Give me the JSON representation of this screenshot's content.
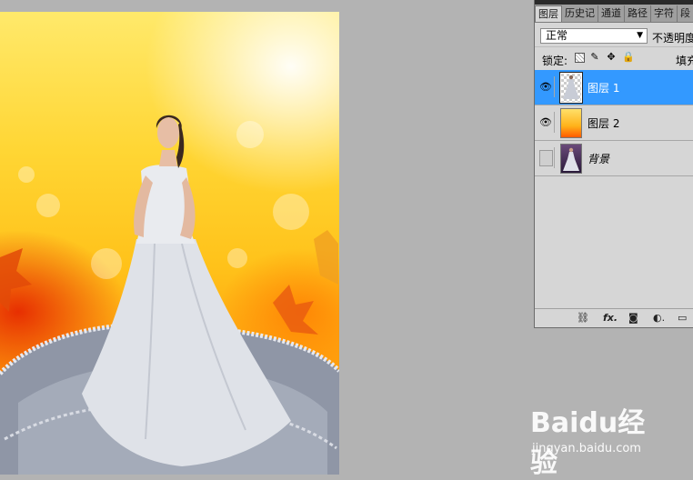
{
  "layers_panel": {
    "tabs": [
      "图层",
      "历史记",
      "通道",
      "路径",
      "字符",
      "段"
    ],
    "blend_mode": "正常",
    "opacity_label": "不透明度",
    "lock_label": "锁定:",
    "fill_label": "填充",
    "layers": [
      {
        "name": "图层 1",
        "selected": true,
        "visible": true,
        "thumbnail": "bride-cutout"
      },
      {
        "name": "图层 2",
        "selected": false,
        "visible": true,
        "thumbnail": "flame-background"
      },
      {
        "name": "背景",
        "selected": false,
        "visible": false,
        "thumbnail": "original-photo"
      }
    ],
    "footer_icons": [
      "link-layers-icon",
      "fx-icon",
      "add-mask-icon",
      "adjustment-layer-icon",
      "new-group-icon"
    ],
    "lock_icons": [
      "lock-transparent-icon",
      "lock-image-icon",
      "lock-position-icon",
      "lock-all-icon"
    ]
  },
  "canvas": {
    "subject": "bride in white wedding gown on yellow-orange bokeh background"
  },
  "watermark": {
    "logo_text": "Baidu经验",
    "url": "jingyan.baidu.com"
  }
}
